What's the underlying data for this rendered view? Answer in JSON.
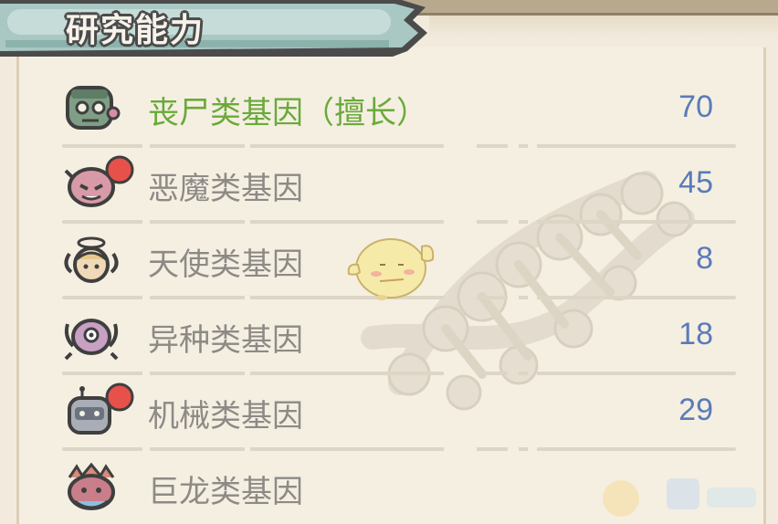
{
  "header": {
    "title": "研究能力"
  },
  "colors": {
    "specialty": "#6aaa3a",
    "label": "#8d8a86",
    "value": "#5a7bb8",
    "tab_fill": "#9fc0bb",
    "tab_border": "#4b4b4b",
    "paper": "#f5efe2"
  },
  "genes": [
    {
      "label": "丧尸类基因（擅长）",
      "value": "70",
      "icon": "zombie-icon",
      "specialty": true,
      "notice": false
    },
    {
      "label": "恶魔类基因",
      "value": "45",
      "icon": "demon-icon",
      "specialty": false,
      "notice": true
    },
    {
      "label": "天使类基因",
      "value": "8",
      "icon": "angel-icon",
      "specialty": false,
      "notice": false
    },
    {
      "label": "异种类基因",
      "value": "18",
      "icon": "alien-icon",
      "specialty": false,
      "notice": false
    },
    {
      "label": "机械类基因",
      "value": "29",
      "icon": "robot-icon",
      "specialty": false,
      "notice": true
    },
    {
      "label": "巨龙类基因",
      "value": "",
      "icon": "dragon-icon",
      "specialty": false,
      "notice": false
    }
  ]
}
